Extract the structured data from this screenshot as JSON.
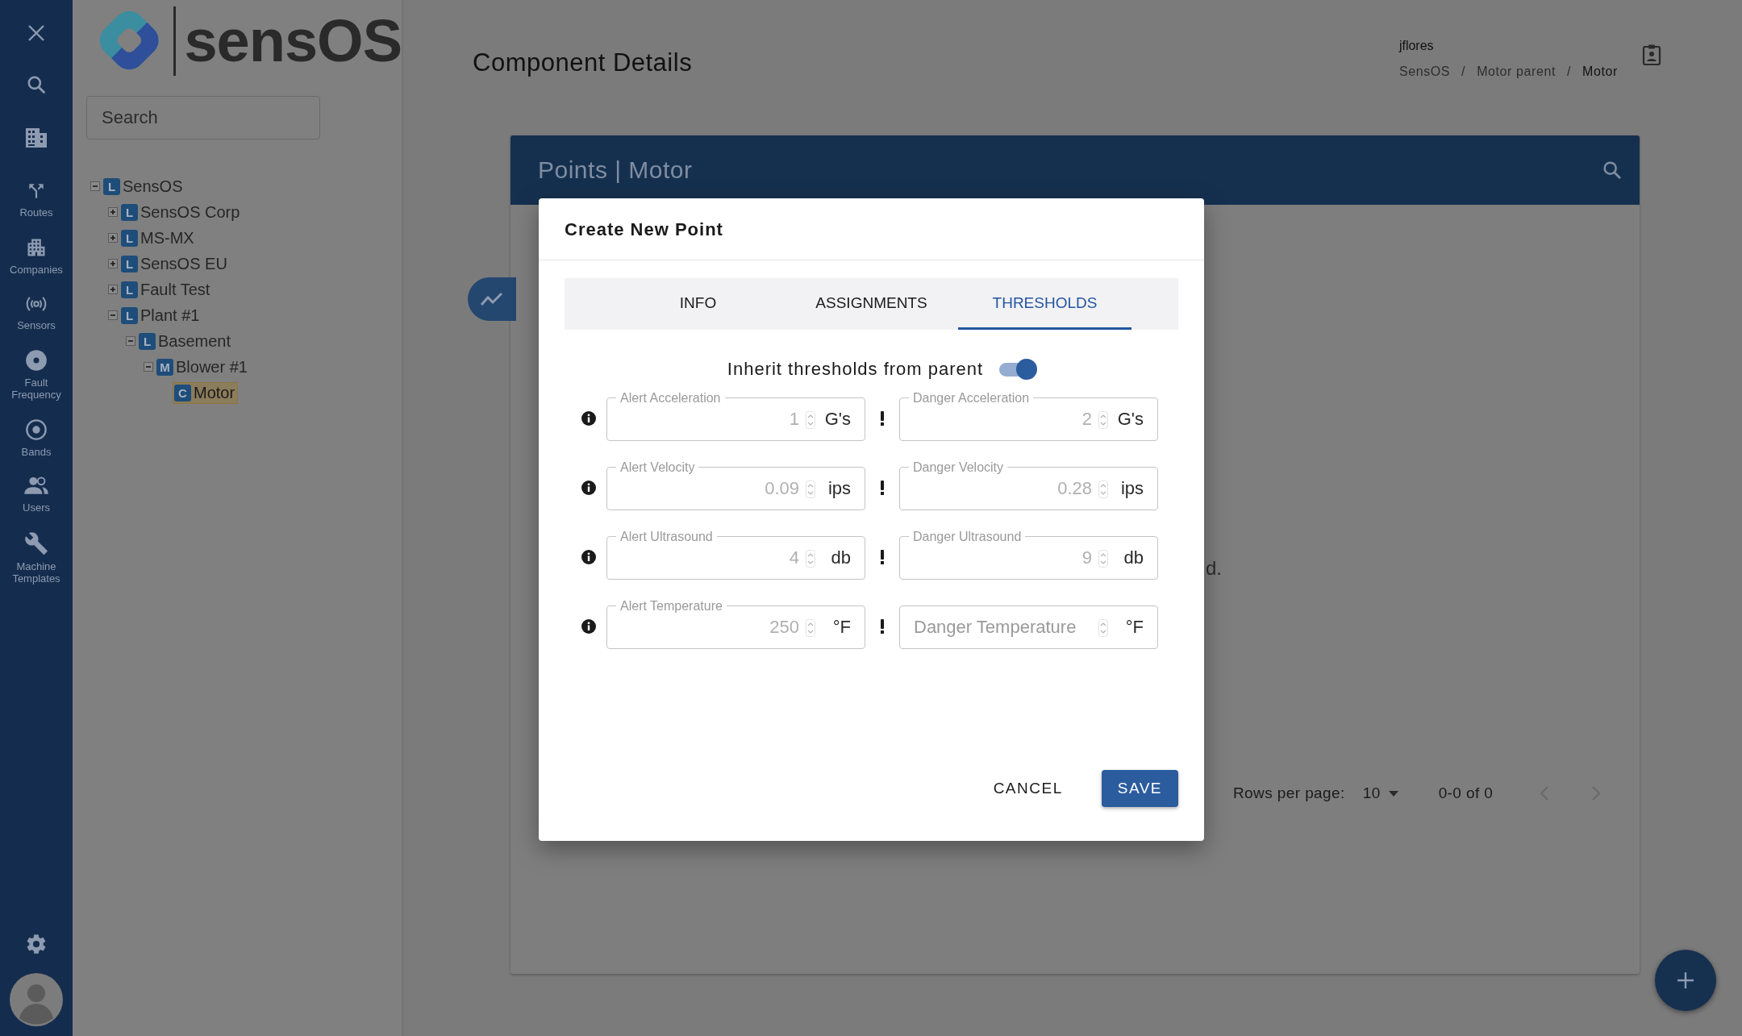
{
  "rail": {
    "items": [
      {
        "label": "Routes"
      },
      {
        "label": "Companies"
      },
      {
        "label": "Sensors"
      },
      {
        "label": "Fault Frequency"
      },
      {
        "label": "Bands"
      },
      {
        "label": "Users"
      },
      {
        "label": "Machine Templates"
      }
    ]
  },
  "logo": {
    "text": "sensOS"
  },
  "tree": {
    "search": {
      "placeholder": "Search"
    },
    "nodes": [
      {
        "badge": "L",
        "label": "SensOS",
        "expanded": true,
        "selected": false,
        "children": [
          {
            "badge": "L",
            "label": "SensOS Corp",
            "expanded": false,
            "selected": false
          },
          {
            "badge": "L",
            "label": "MS-MX",
            "expanded": false,
            "selected": false
          },
          {
            "badge": "L",
            "label": "SensOS EU",
            "expanded": false,
            "selected": false
          },
          {
            "badge": "L",
            "label": "Fault Test",
            "expanded": false,
            "selected": false
          },
          {
            "badge": "L",
            "label": "Plant #1",
            "expanded": true,
            "selected": false,
            "children": [
              {
                "badge": "L",
                "label": "Basement",
                "expanded": true,
                "selected": false,
                "children": [
                  {
                    "badge": "M",
                    "label": "Blower #1",
                    "expanded": true,
                    "selected": false,
                    "children": [
                      {
                        "badge": "C",
                        "label": "Motor",
                        "selected": true
                      }
                    ]
                  }
                ]
              }
            ]
          }
        ]
      }
    ]
  },
  "header": {
    "title": "Component Details",
    "user": "jflores",
    "separator": "/",
    "breadcrumbs": [
      {
        "label": "SensOS",
        "current": false
      },
      {
        "label": "Motor parent",
        "current": false
      },
      {
        "label": "Motor",
        "current": true
      }
    ]
  },
  "card": {
    "title": "Points | Motor",
    "hidden_text": "d.",
    "pagination": {
      "rows_label": "Rows per page:",
      "rows_value": "10",
      "range": "0-0 of 0"
    }
  },
  "dialog": {
    "title": "Create New Point",
    "tabs": [
      {
        "label": "INFO",
        "selected": false
      },
      {
        "label": "ASSIGNMENTS",
        "selected": false
      },
      {
        "label": "THRESHOLDS",
        "selected": true
      }
    ],
    "inherit": {
      "label": "Inherit thresholds from parent",
      "on": true
    },
    "thresholds": [
      {
        "alert": {
          "label": "Alert Acceleration",
          "value": "1",
          "unit": "G's"
        },
        "danger": {
          "label": "Danger Acceleration",
          "value": "2",
          "unit": "G's"
        }
      },
      {
        "alert": {
          "label": "Alert Velocity",
          "value": "0.09",
          "unit": "ips"
        },
        "danger": {
          "label": "Danger Velocity",
          "value": "0.28",
          "unit": "ips"
        }
      },
      {
        "alert": {
          "label": "Alert Ultrasound",
          "value": "4",
          "unit": "db"
        },
        "danger": {
          "label": "Danger Ultrasound",
          "value": "9",
          "unit": "db"
        }
      },
      {
        "alert": {
          "label": "Alert Temperature",
          "value": "250",
          "unit": "°F"
        },
        "danger": {
          "placeholder": "Danger Temperature",
          "unit": "°F"
        }
      }
    ],
    "buttons": [
      {
        "label": "CANCEL",
        "kind": "text"
      },
      {
        "label": "SAVE",
        "kind": "primary"
      }
    ]
  }
}
